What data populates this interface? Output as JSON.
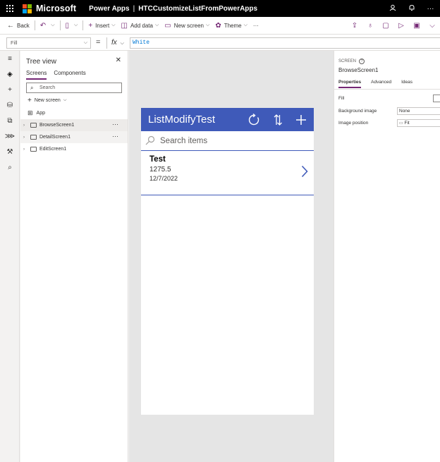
{
  "topbar": {
    "brand": "Microsoft",
    "product": "Power Apps",
    "separator": "|",
    "app_name": "HTCCustomizeListFromPowerApps",
    "microsoft_logo_colors": [
      "#f25022",
      "#7fba00",
      "#00a4ef",
      "#ffb900"
    ]
  },
  "command_bar": {
    "back": "Back",
    "insert": "Insert",
    "add_data": "Add data",
    "new_screen": "New screen",
    "theme": "Theme",
    "more": "···"
  },
  "formula_bar": {
    "property": "Fill",
    "equals": "=",
    "fx": "fx",
    "formula": "White"
  },
  "tree_view": {
    "title": "Tree view",
    "tabs": [
      "Screens",
      "Components"
    ],
    "search_placeholder": "Search",
    "new_screen": "New screen",
    "app_item": "App",
    "screens": [
      {
        "name": "BrowseScreen1",
        "more": "···"
      },
      {
        "name": "DetailScreen1",
        "more": "···"
      },
      {
        "name": "EditScreen1",
        "more": ""
      }
    ]
  },
  "app_screen": {
    "title": "ListModifyTest",
    "search_placeholder": "Search items",
    "header_color": "#3f5ab9",
    "item": {
      "title": "Test",
      "subtitle": "1275.5",
      "body": "12/7/2022"
    }
  },
  "properties": {
    "type_label": "SCREEN",
    "screen_name": "BrowseScreen1",
    "tabs": [
      "Properties",
      "Advanced",
      "Ideas"
    ],
    "fill_label": "Fill",
    "background_image_label": "Background image",
    "background_image_value": "None",
    "image_position_label": "Image position",
    "image_position_value": "Fit"
  },
  "accent_color": "#742774"
}
